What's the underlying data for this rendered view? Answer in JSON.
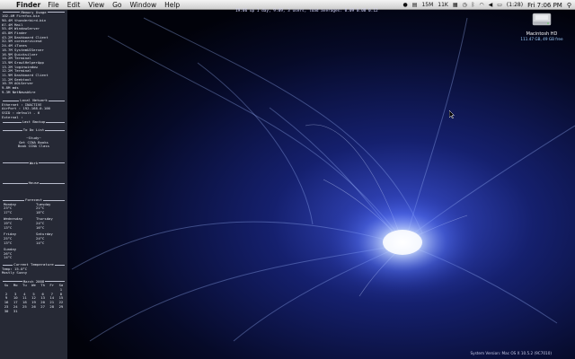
{
  "menubar": {
    "app": "Finder",
    "items": [
      "File",
      "Edit",
      "View",
      "Go",
      "Window",
      "Help"
    ],
    "status": [
      "15M",
      "11K"
    ],
    "battery": "(1:28)",
    "clock": "Fri 7:06 PM"
  },
  "uptime": "19:06 up 1 day, 9:09, 3 users, load averages: 0.09 0.08 0.12",
  "panel": {
    "memory_usage": {
      "title": "Memory Usage",
      "items": [
        "102.4M Firefox-bin",
        "90.4M thunderbird-bin",
        "67.4M Mail",
        "55.4M WindowServer",
        "45.8M Finder",
        "43.2M Dashboard Client",
        "32.5M coreservicesd",
        "24.4M iTunes",
        "18.7M SystemUIServer",
        "16.9M Quicksilver",
        "14.2M Terminal",
        "13.9M GrowlHelperApp",
        "13.2M loginwindow",
        "12.2M Terminal",
        "11.9M Dashboard Client",
        "11.2M Geektool",
        "10.7M AOLServer",
        "9.8M mds",
        "9.3M NetNewsWire"
      ]
    },
    "local_network": {
      "title": "Local Network",
      "items": [
        "Ethernet : INACTIVE",
        "AirPort : 192.168.0.100",
        "SSID : default - 6",
        "External : "
      ]
    },
    "last_backup": {
      "title": "Last Backup"
    },
    "todo": {
      "title": "To Do List",
      "heading": "~Study~",
      "items": [
        "Get CCNA Books",
        "Book CCNA Class"
      ]
    },
    "work": {
      "title": "Work"
    },
    "house": {
      "title": "House"
    },
    "forecast": {
      "title": "Forecast",
      "days": [
        {
          "day": "Monday",
          "hi": "23°C",
          "lo": "17°C"
        },
        {
          "day": "Tuesday",
          "hi": "21°C",
          "lo": "18°C"
        },
        {
          "day": "Wednesday",
          "hi": "19°C",
          "lo": "13°C"
        },
        {
          "day": "Thursday",
          "hi": "24°C",
          "lo": "16°C"
        },
        {
          "day": "Friday",
          "hi": "25°C",
          "lo": "13°C"
        },
        {
          "day": "Saturday",
          "hi": "24°C",
          "lo": "14°C"
        },
        {
          "day": "Sunday",
          "hi": "26°C",
          "lo": "14°C"
        }
      ]
    },
    "current_temp": {
      "title": "Current Temperature",
      "items": [
        "Temp: 15.0°C",
        "Mostly Sunny"
      ]
    },
    "calendar": {
      "title": "March 2008",
      "weekdays": [
        "Su",
        "Mo",
        "Tu",
        "We",
        "Th",
        "Fr",
        "Sa"
      ],
      "cells": [
        "",
        "",
        "",
        "",
        "",
        "",
        "1",
        "2",
        "3",
        "4",
        "5",
        "6",
        "7",
        "8",
        "9",
        "10",
        "11",
        "12",
        "13",
        "14",
        "15",
        "16",
        "17",
        "18",
        "19",
        "20",
        "21",
        "22",
        "23",
        "24",
        "25",
        "26",
        "27",
        "28",
        "29",
        "30",
        "31",
        "",
        "",
        "",
        "",
        ""
      ]
    }
  },
  "drive": {
    "name": "Macintosh HD",
    "info": "111.47 GB, 49 GB free"
  },
  "system_version": "System Version: Mac OS X 10.5.2 (9C7010)"
}
